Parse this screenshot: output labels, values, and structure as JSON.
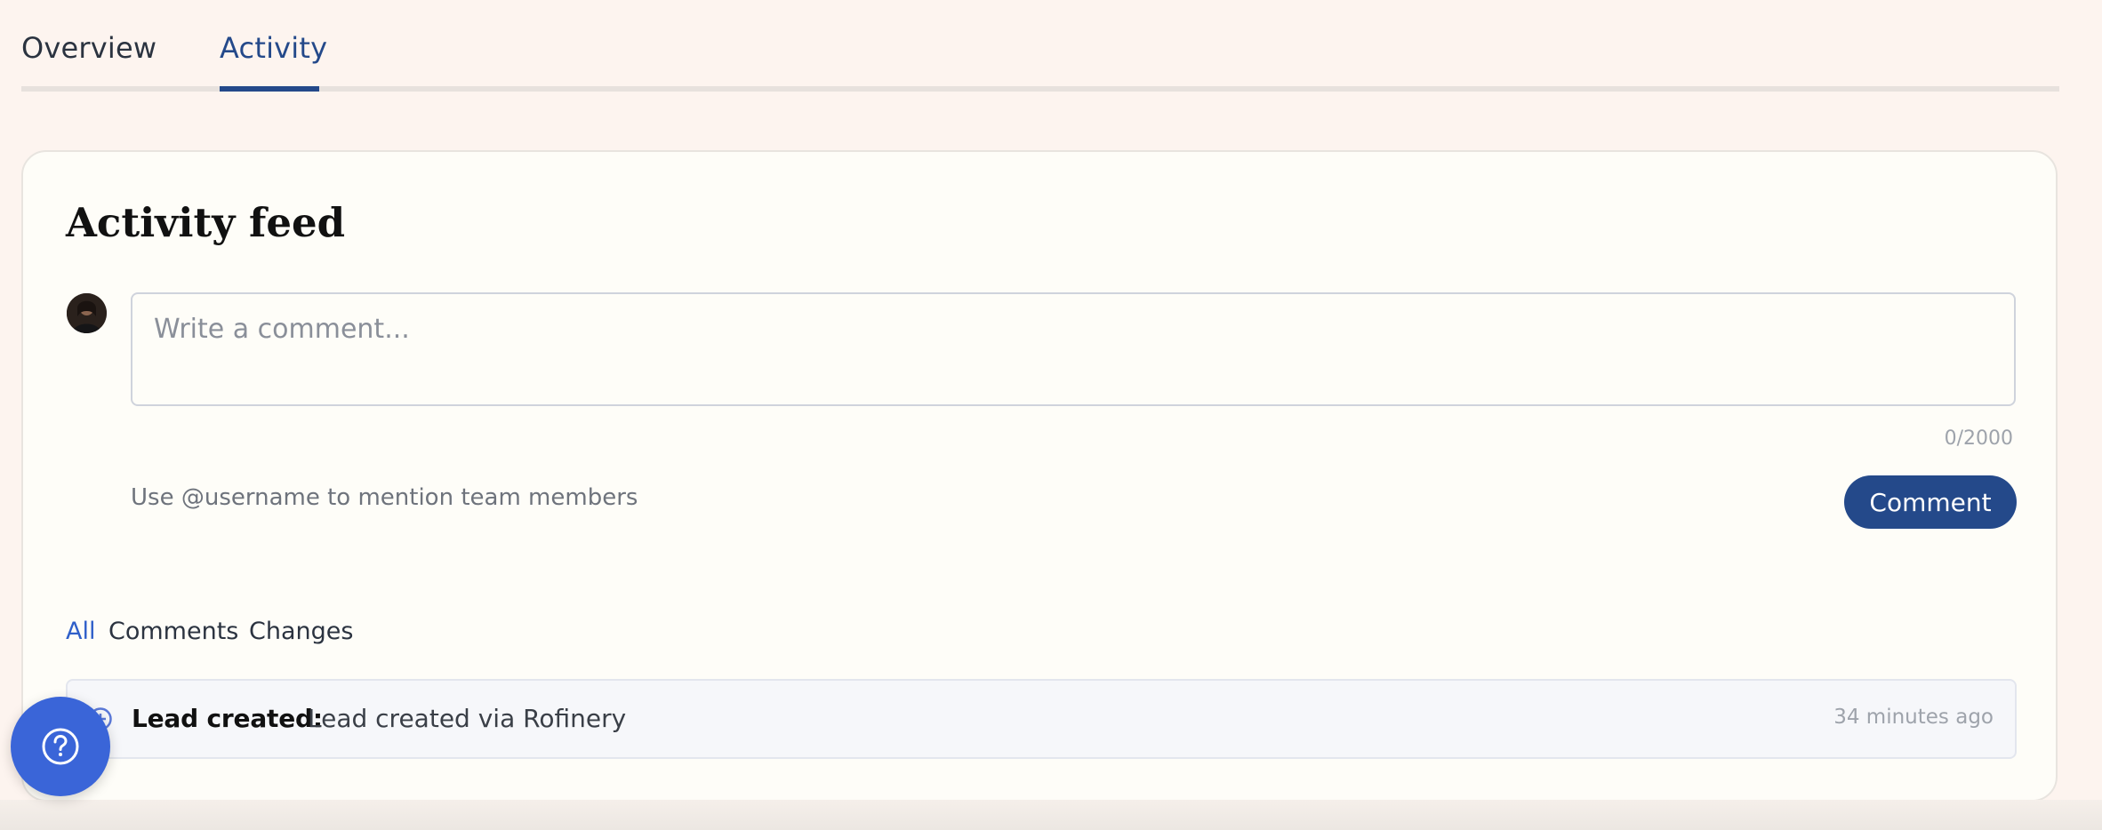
{
  "tabs": [
    {
      "label": "Overview",
      "active": false
    },
    {
      "label": "Activity",
      "active": true
    }
  ],
  "feed": {
    "title": "Activity feed",
    "comment_placeholder": "Write a comment...",
    "char_count": "0/2000",
    "mention_hint": "Use @username to mention team members",
    "comment_button": "Comment"
  },
  "filters": [
    {
      "label": "All",
      "active": true
    },
    {
      "label": "Comments",
      "active": false
    },
    {
      "label": "Changes",
      "active": false
    }
  ],
  "activity_items": [
    {
      "icon": "plus-circle-icon",
      "label": "Lead created:",
      "text": "Lead created via Rofinery",
      "time": "34 minutes ago"
    }
  ],
  "help": {
    "icon": "question-circle-icon"
  },
  "colors": {
    "accent": "#24498a",
    "link": "#2f5fc9",
    "help": "#3a65d8",
    "background": "#fdf4ef",
    "card": "#fefdf8"
  }
}
